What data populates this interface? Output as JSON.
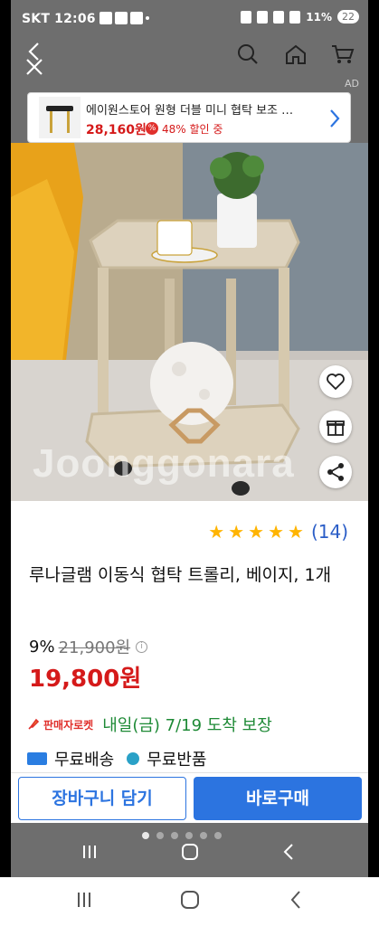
{
  "status": {
    "time": "SKT 12:06",
    "battery": "11%",
    "notif": "22"
  },
  "nav": {
    "back": "back-icon",
    "close": "close-icon",
    "search": "search-icon",
    "home": "home-icon",
    "cart": "cart-icon",
    "ad_label": "AD"
  },
  "ad": {
    "title": "에이원스토어 원형 더블 미니 협탁 보조 …",
    "price": "28,160원",
    "discount": "48% 할인 중",
    "badge": "%"
  },
  "image": {
    "watermark": "Joonggonara"
  },
  "product": {
    "rating_count": "(14)",
    "title": "루나글램 이동식 협탁 트롤리, 베이지, 1개",
    "discount_pct": "9%",
    "original_price": "21,900원",
    "sale_price": "19,800원",
    "rocket_label": "판매자로켓",
    "delivery": "내일(금) 7/19 도착 보장",
    "free_shipping": "무료배송",
    "free_return": "무료반품"
  },
  "buttons": {
    "cart": "장바구니 담기",
    "buy": "바로구매"
  },
  "colors": {
    "accent": "#2c74e0",
    "price": "#d51a1a",
    "delivery": "#1e8a36",
    "star": "#ffb400"
  }
}
